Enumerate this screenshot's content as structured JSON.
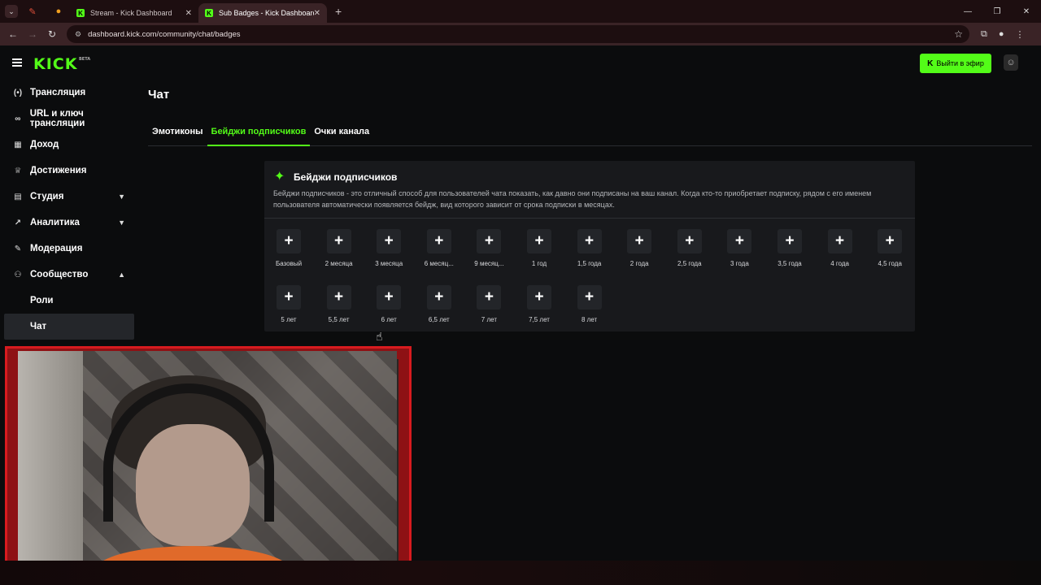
{
  "browser": {
    "tabs": [
      {
        "title": "Stream - Kick Dashboard",
        "active": false
      },
      {
        "title": "Sub Badges - Kick Dashboard",
        "active": true
      }
    ],
    "url": "dashboard.kick.com/community/chat/badges"
  },
  "header": {
    "logo": "KICK",
    "logo_tag": "BETA",
    "go_live_label": "Выйти в эфир",
    "accent_color": "#53fc18"
  },
  "sidebar": {
    "items": [
      {
        "label": "Трансляция",
        "icon": "broadcast-icon"
      },
      {
        "label": "URL и ключ трансляции",
        "icon": "link-icon"
      },
      {
        "label": "Доход",
        "icon": "revenue-icon"
      },
      {
        "label": "Достижения",
        "icon": "trophy-icon"
      },
      {
        "label": "Студия",
        "icon": "studio-icon"
      },
      {
        "label": "Аналитика",
        "icon": "analytics-icon"
      },
      {
        "label": "Модерация",
        "icon": "wrench-icon"
      },
      {
        "label": "Сообщество",
        "icon": "community-icon"
      }
    ],
    "sub_items": [
      {
        "label": "Роли"
      },
      {
        "label": "Чат",
        "active": true
      }
    ]
  },
  "main": {
    "title": "Чат",
    "tabs": [
      {
        "label": "Эмотиконы",
        "active": false
      },
      {
        "label": "Бейджи подписчиков",
        "active": true
      },
      {
        "label": "Очки канала",
        "active": false
      }
    ],
    "card": {
      "title": "Бейджи подписчиков",
      "description": "Бейджи подписчиков - это отличный способ для пользователей чата показать, как давно они подписаны на ваш канал. Когда кто-то приобретает подписку, рядом с его именем пользователя автоматически появляется бейдж, вид которого зависит от срока подписки в месяцах.",
      "badges": [
        "Базовый",
        "2 месяца",
        "3 месяца",
        "6 месяц...",
        "9 месяц...",
        "1 год",
        "1,5 года",
        "2 года",
        "2,5 года",
        "3 года",
        "3,5 года",
        "4 года",
        "4,5 года",
        "5 лет",
        "5,5 лет",
        "6 лет",
        "6,5 лет",
        "7 лет",
        "7,5 лет",
        "8 лет"
      ]
    }
  }
}
